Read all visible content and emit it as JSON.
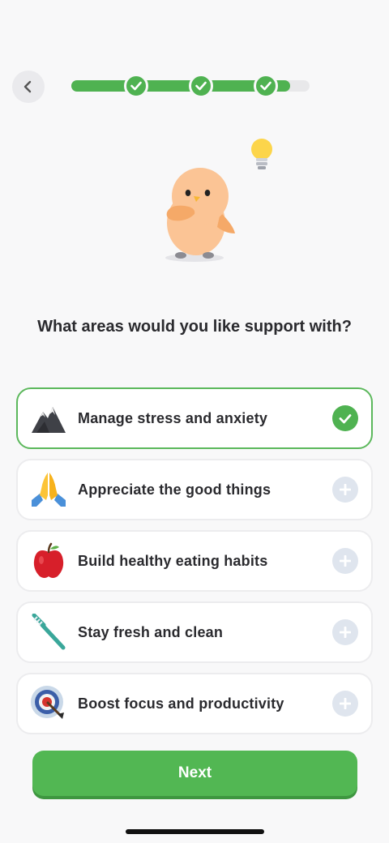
{
  "progress": {
    "completed_steps": 3,
    "total_steps": 4,
    "fill_fraction": 0.92
  },
  "question": "What areas would you like support with?",
  "options": [
    {
      "label": "Manage stress and anxiety",
      "icon": "mountain-icon",
      "selected": true
    },
    {
      "label": "Appreciate the good things",
      "icon": "praying-hands-icon",
      "selected": false
    },
    {
      "label": "Build healthy eating habits",
      "icon": "apple-icon",
      "selected": false
    },
    {
      "label": "Stay fresh and clean",
      "icon": "toothbrush-icon",
      "selected": false
    },
    {
      "label": "Boost focus and productivity",
      "icon": "target-icon",
      "selected": false
    }
  ],
  "next_button": {
    "label": "Next"
  },
  "colors": {
    "accent": "#4fb251",
    "background": "#f8f8f9",
    "unselected": "#dfe5ee"
  }
}
